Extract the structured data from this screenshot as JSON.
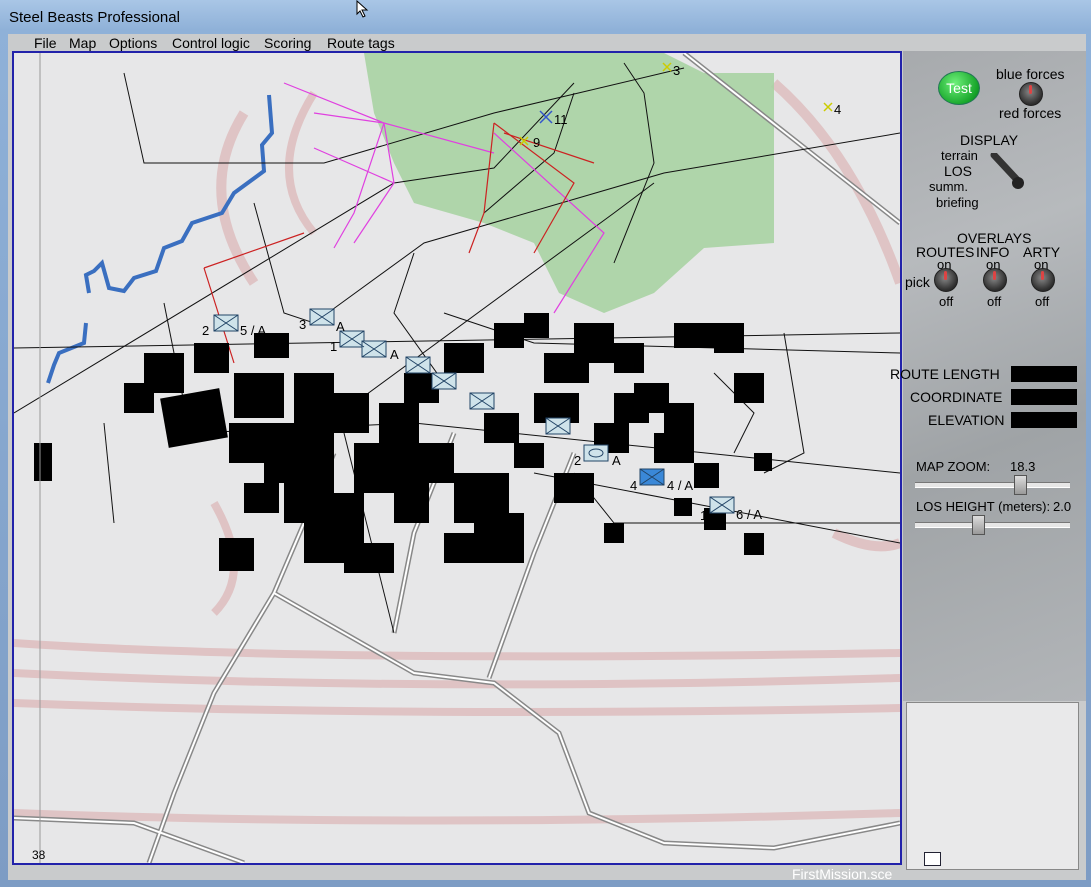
{
  "window": {
    "title": "Steel Beasts Professional"
  },
  "menu": [
    {
      "label": "File"
    },
    {
      "label": "Map"
    },
    {
      "label": "Options"
    },
    {
      "label": "Control logic"
    },
    {
      "label": "Scoring"
    },
    {
      "label": "Route tags"
    }
  ],
  "map": {
    "corner_label": "38",
    "waypoints": [
      {
        "label": "3"
      },
      {
        "label": "4"
      },
      {
        "label": "11"
      },
      {
        "label": "9"
      }
    ],
    "unit_labels": [
      {
        "num": "2",
        "tag": "5 / A"
      },
      {
        "num": "3",
        "tag": "A"
      },
      {
        "num": "4",
        "tag": "4 / A"
      },
      {
        "num": "1",
        "tag": "6 / A"
      },
      {
        "num": "2",
        "tag": "A"
      },
      {
        "num": "1",
        "tag": "A"
      }
    ]
  },
  "panel": {
    "test_label": "Test",
    "blue_forces": "blue forces",
    "red_forces": "red forces",
    "display": "DISPLAY",
    "display_opts": [
      "terrain",
      "LOS",
      "summ.",
      "briefing"
    ],
    "overlays": "OVERLAYS",
    "overlay_cols": [
      {
        "title": "ROUTES",
        "on": "on",
        "off": "off"
      },
      {
        "title": "INFO",
        "on": "on",
        "off": "off"
      },
      {
        "title": "ARTY",
        "on": "on",
        "off": "off"
      }
    ],
    "pick": "pick",
    "route_length": "ROUTE  LENGTH",
    "coordinate": "COORDINATE",
    "elevation": "ELEVATION",
    "map_zoom_label": "MAP ZOOM:",
    "map_zoom_value": "18.3",
    "los_height_label": "LOS HEIGHT (meters):",
    "los_height_value": "2.0"
  },
  "status": {
    "file": "FirstMission.sce"
  },
  "colors": {
    "forest": "#a8d3a3",
    "river": "#3a6fc0",
    "route_magenta": "#e040e0",
    "route_red": "#cc2222",
    "frame": "#2222aa"
  }
}
